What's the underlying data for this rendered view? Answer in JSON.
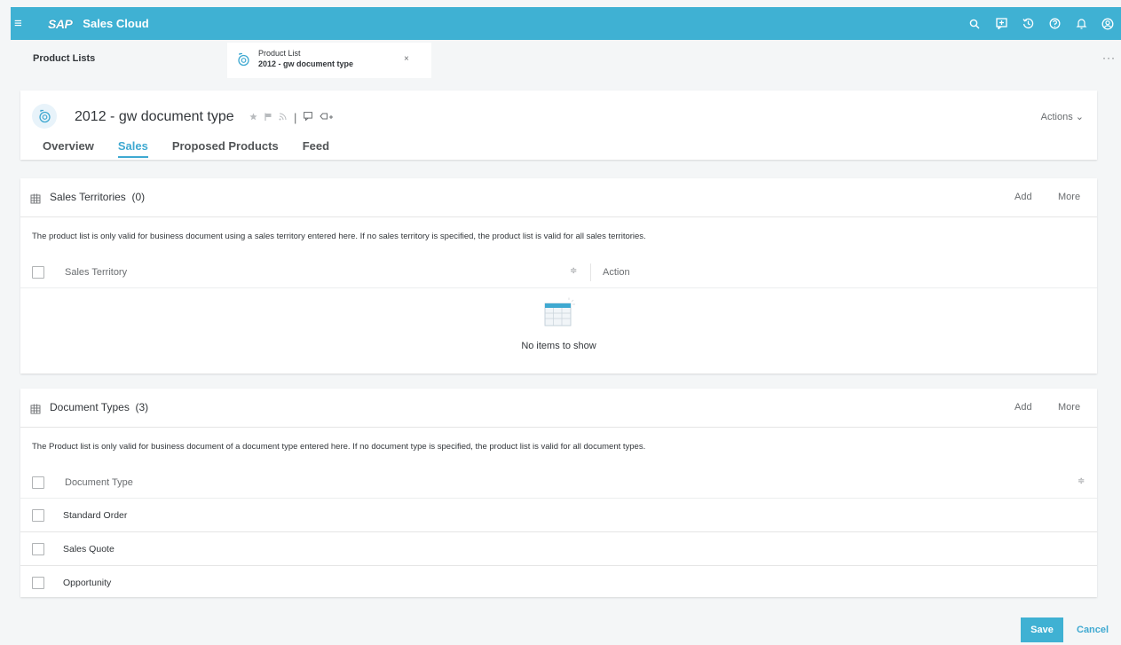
{
  "shellbar": {
    "logo": "SAP",
    "app_title": "Sales Cloud",
    "icons": [
      "search-icon",
      "chat-icon",
      "history-icon",
      "help-icon",
      "notification-icon",
      "user-icon"
    ]
  },
  "tabstrip": {
    "root_label": "Product Lists",
    "object_tab": {
      "type": "Product List",
      "name": "2012 - gw document type"
    },
    "close_glyph": "×",
    "overflow_glyph": "···"
  },
  "header": {
    "title": "2012 - gw document type",
    "actions_label": "Actions",
    "tabs": [
      {
        "label": "Overview"
      },
      {
        "label": "Sales"
      },
      {
        "label": "Proposed Products"
      },
      {
        "label": "Feed"
      }
    ],
    "active_tab": "Sales"
  },
  "sales_territories": {
    "title": "Sales Territories",
    "count": "(0)",
    "add_label": "Add",
    "more_label": "More",
    "description": "The product list is only valid for business document using a sales territory entered here. If no sales territory is specified, the product list is valid for all sales territories.",
    "columns": [
      "Sales Territory",
      "Action"
    ],
    "empty_text": "No items to show"
  },
  "document_types": {
    "title": "Document Types",
    "count": "(3)",
    "add_label": "Add",
    "more_label": "More",
    "description": "The Product list is only valid for business document of a document type entered here. If no document type is specified, the product list is valid for all document types.",
    "column": "Document Type",
    "rows": [
      "Standard Order",
      "Sales Quote",
      "Opportunity"
    ]
  },
  "footer": {
    "save_label": "Save",
    "cancel_label": "Cancel"
  },
  "colors": {
    "shellbar": "#3fb1d3",
    "accent": "#3fa9d1",
    "text": "#32363a"
  }
}
